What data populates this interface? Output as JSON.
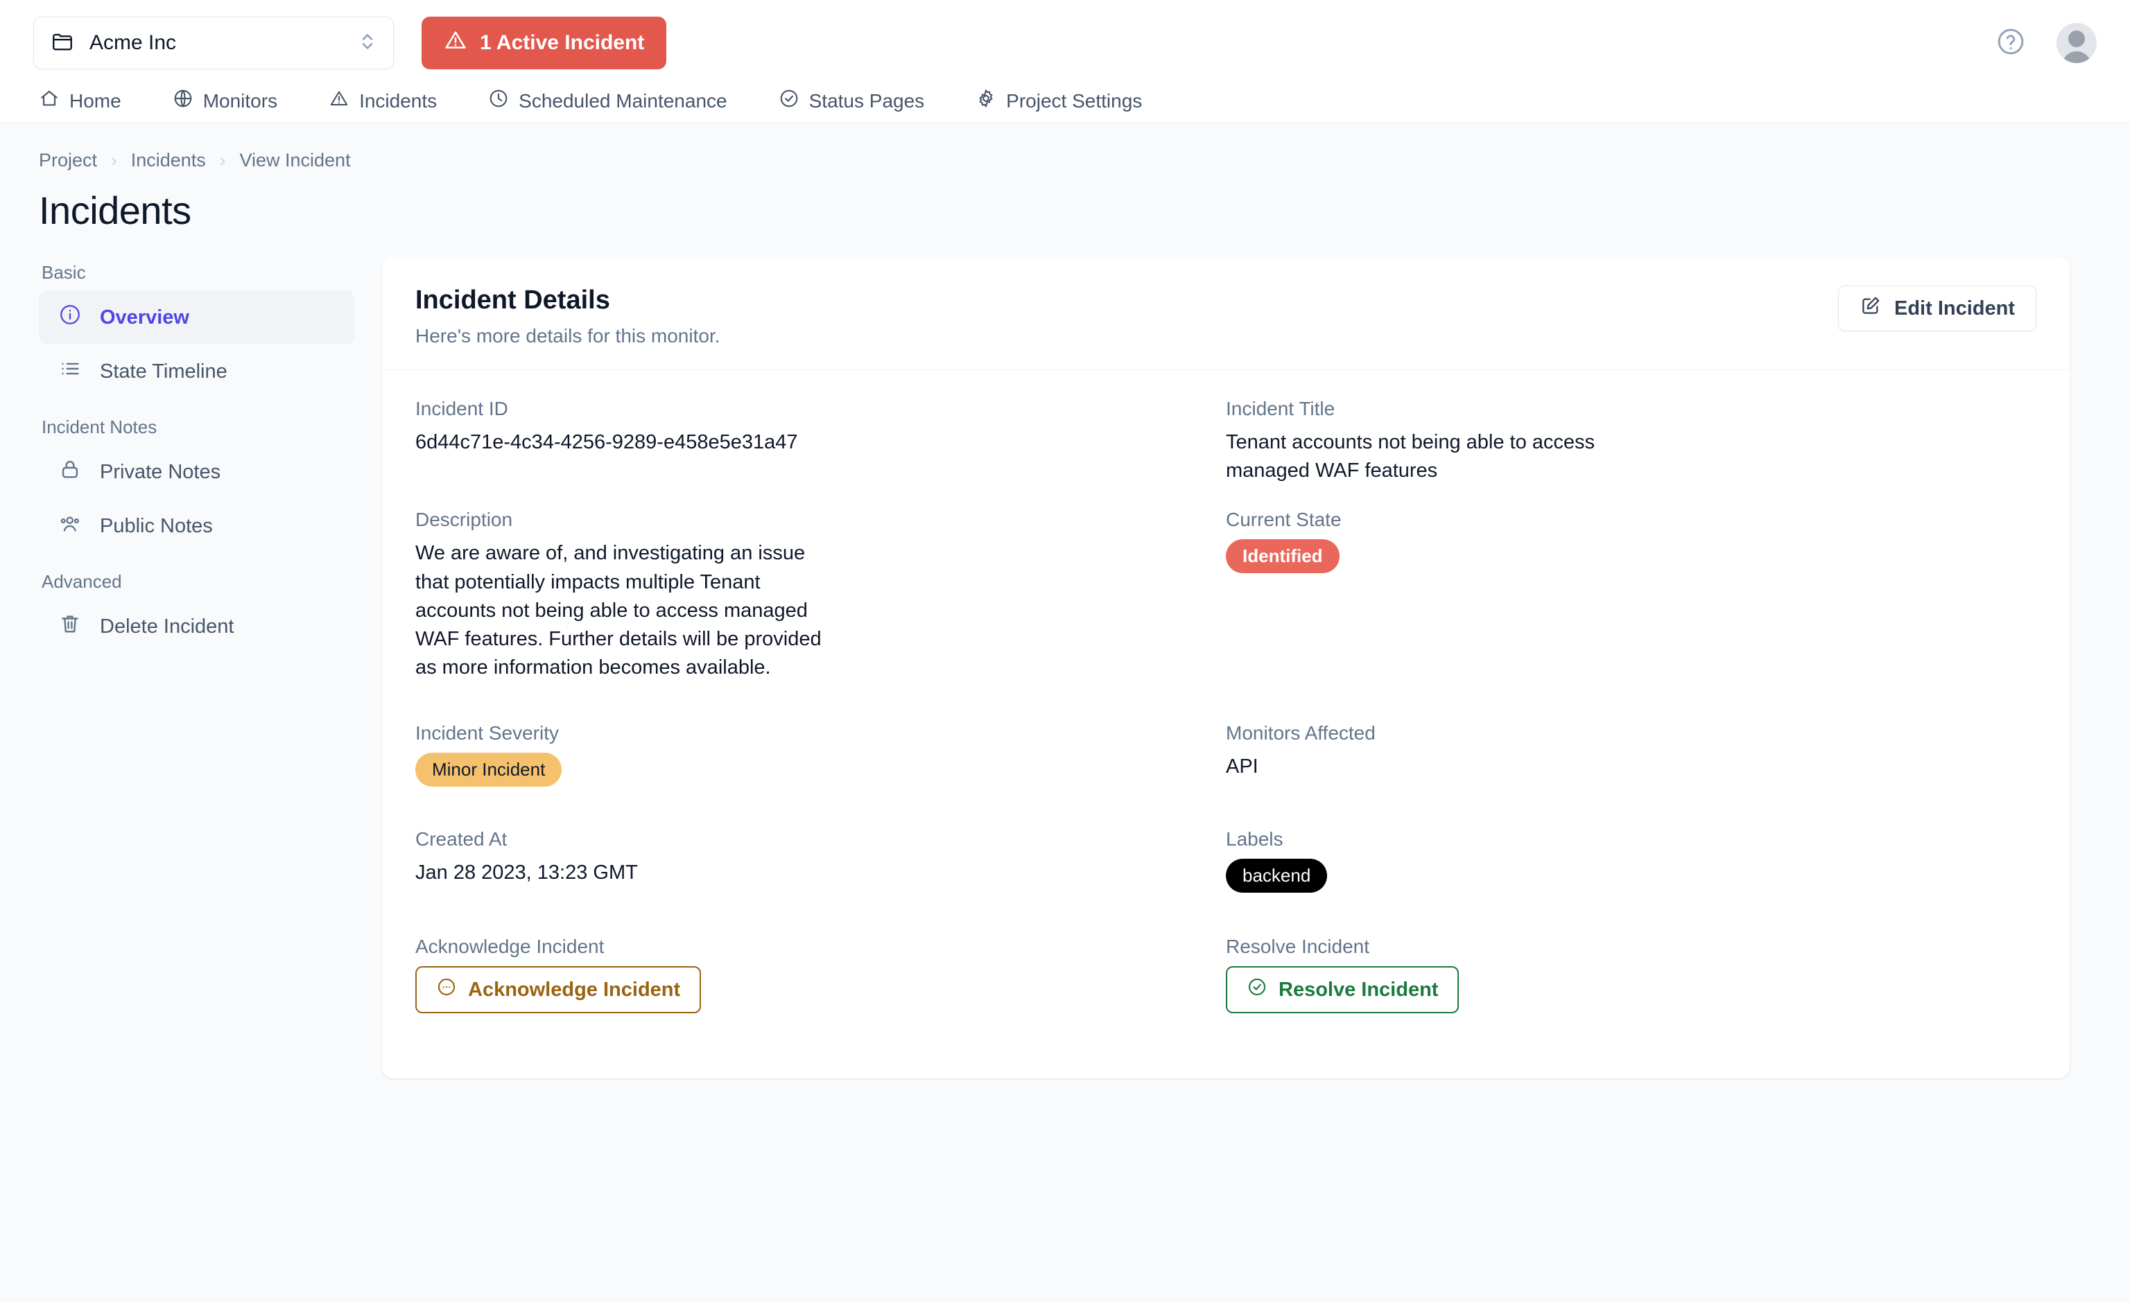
{
  "topbar": {
    "project_name": "Acme Inc",
    "active_incident_label": "1 Active Incident",
    "help_icon": "question-circle-icon",
    "avatar_icon": "user-avatar-icon"
  },
  "nav": {
    "items": [
      {
        "label": "Home",
        "icon": "home-icon"
      },
      {
        "label": "Monitors",
        "icon": "globe-icon"
      },
      {
        "label": "Incidents",
        "icon": "warning-triangle-icon"
      },
      {
        "label": "Scheduled Maintenance",
        "icon": "clock-icon"
      },
      {
        "label": "Status Pages",
        "icon": "check-circle-icon"
      },
      {
        "label": "Project Settings",
        "icon": "gear-icon"
      }
    ]
  },
  "breadcrumb": {
    "items": [
      "Project",
      "Incidents",
      "View Incident"
    ],
    "separator": "›"
  },
  "page": {
    "title": "Incidents"
  },
  "sidebar": {
    "groups": [
      {
        "title": "Basic",
        "items": [
          {
            "label": "Overview",
            "icon": "info-circle-icon",
            "active": true
          },
          {
            "label": "State Timeline",
            "icon": "list-icon",
            "active": false
          }
        ]
      },
      {
        "title": "Incident Notes",
        "items": [
          {
            "label": "Private Notes",
            "icon": "lock-icon",
            "active": false
          },
          {
            "label": "Public Notes",
            "icon": "users-icon",
            "active": false
          }
        ]
      },
      {
        "title": "Advanced",
        "items": [
          {
            "label": "Delete Incident",
            "icon": "trash-icon",
            "active": false
          }
        ]
      }
    ]
  },
  "card": {
    "title": "Incident Details",
    "subtitle": "Here's more details for this monitor.",
    "edit_button": "Edit Incident",
    "edit_icon": "pencil-square-icon",
    "fields": {
      "incident_id": {
        "label": "Incident ID",
        "value": "6d44c71e-4c34-4256-9289-e458e5e31a47"
      },
      "incident_title": {
        "label": "Incident Title",
        "value": "Tenant accounts not being able to access managed WAF features"
      },
      "description": {
        "label": "Description",
        "value": "We are aware of, and investigating an issue that potentially impacts multiple Tenant accounts not being able to access managed WAF features. Further details will be provided as more information becomes available."
      },
      "current_state": {
        "label": "Current State",
        "value": "Identified",
        "color": "#e9685b"
      },
      "incident_severity": {
        "label": "Incident Severity",
        "value": "Minor Incident",
        "color": "#f5c16c"
      },
      "monitors_affected": {
        "label": "Monitors Affected",
        "value": "API"
      },
      "created_at": {
        "label": "Created At",
        "value": "Jan 28 2023, 13:23 GMT"
      },
      "labels": {
        "label": "Labels",
        "values": [
          "backend"
        ],
        "color": "#000000"
      },
      "acknowledge": {
        "label": "Acknowledge Incident",
        "button": "Acknowledge Incident",
        "icon": "dots-circle-icon",
        "color": "#9a6310"
      },
      "resolve": {
        "label": "Resolve Incident",
        "button": "Resolve Incident",
        "icon": "check-circle-icon",
        "color": "#1b7a3d"
      }
    }
  },
  "colors": {
    "accent": "#4f46e5",
    "danger": "#e2584d",
    "page_bg": "#f8fafc",
    "card_bg": "#ffffff"
  }
}
